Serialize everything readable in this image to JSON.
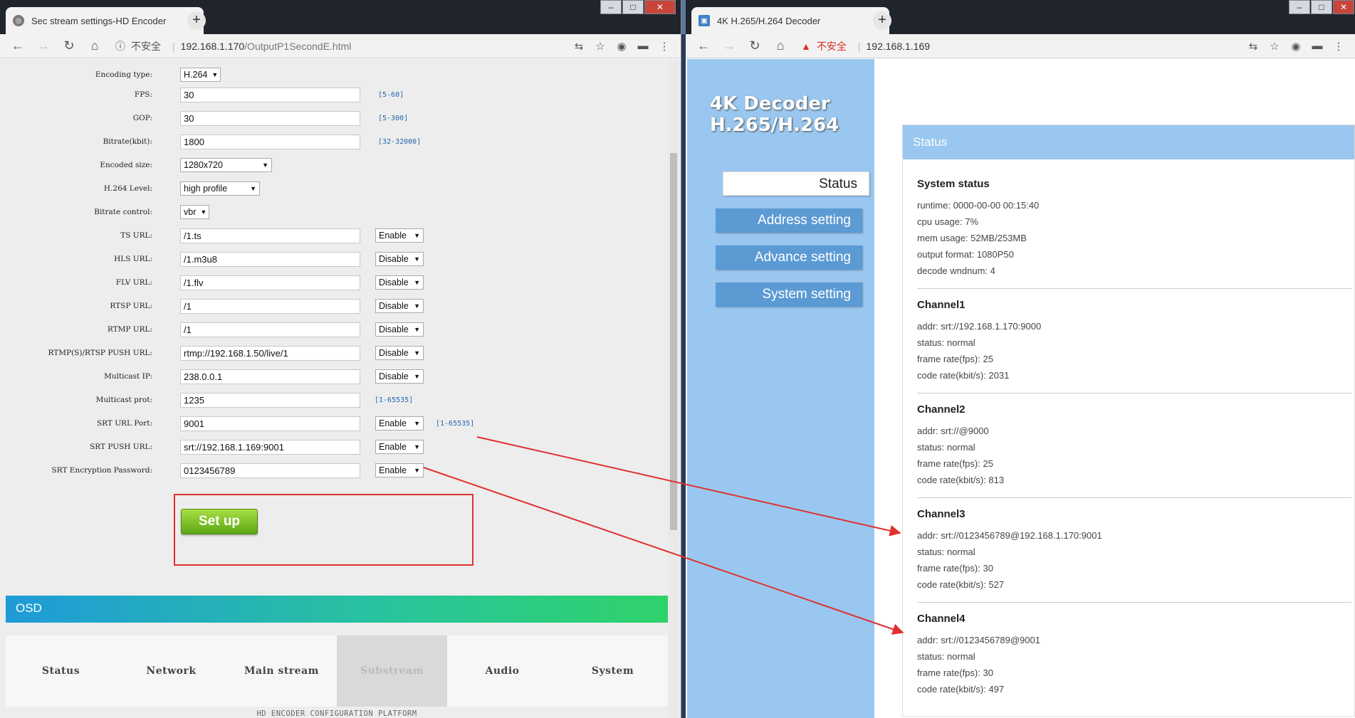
{
  "left_window": {
    "tab_title": "Sec stream settings-HD Encoder",
    "security": "不安全",
    "url_host": "192.168.1.170",
    "url_path": "/OutputP1SecondE.html",
    "form": {
      "encoding_type": {
        "label": "Encoding type:",
        "value": "H.264"
      },
      "fps": {
        "label": "FPS:",
        "value": "30",
        "hint": "[5-60]"
      },
      "gop": {
        "label": "GOP:",
        "value": "30",
        "hint": "[5-300]"
      },
      "bitrate": {
        "label": "Bitrate(kbit):",
        "value": "1800",
        "hint": "[32-32000]"
      },
      "encoded_size": {
        "label": "Encoded size:",
        "value": "1280x720"
      },
      "h264_level": {
        "label": "H.264 Level:",
        "value": "high profile"
      },
      "bitrate_control": {
        "label": "Bitrate control:",
        "value": "vbr"
      },
      "ts_url": {
        "label": "TS URL:",
        "value": "/1.ts",
        "state": "Enable"
      },
      "hls_url": {
        "label": "HLS URL:",
        "value": "/1.m3u8",
        "state": "Disable"
      },
      "flv_url": {
        "label": "FLV URL:",
        "value": "/1.flv",
        "state": "Disable"
      },
      "rtsp_url": {
        "label": "RTSP URL:",
        "value": "/1",
        "state": "Disable"
      },
      "rtmp_url": {
        "label": "RTMP URL:",
        "value": "/1",
        "state": "Disable"
      },
      "rtmp_push_url": {
        "label": "RTMP(S)/RTSP PUSH URL:",
        "value": "rtmp://192.168.1.50/live/1",
        "state": "Disable"
      },
      "multicast_ip": {
        "label": "Multicast IP:",
        "value": "238.0.0.1",
        "state": "Disable"
      },
      "multicast_port": {
        "label": "Multicast prot:",
        "value": "1235",
        "hint": "[1-65535]"
      },
      "srt_url_port": {
        "label": "SRT URL Port:",
        "value": "9001",
        "state": "Enable",
        "hint": "[1-65535]"
      },
      "srt_push_url": {
        "label": "SRT PUSH URL:",
        "value": "srt://192.168.1.169:9001",
        "state": "Enable"
      },
      "srt_password": {
        "label": "SRT Encryption Password:",
        "value": "0123456789",
        "state": "Enable"
      }
    },
    "setup_label": "Set up",
    "osd_label": "OSD",
    "nav": [
      "Status",
      "Network",
      "Main stream",
      "Substream",
      "Audio",
      "System"
    ],
    "nav_active": "Substream",
    "footer": "HD ENCODER CONFIGURATION PLATFORM"
  },
  "right_window": {
    "tab_title": "4K H.265/H.264 Decoder",
    "security": "不安全",
    "url_host": "192.168.1.169",
    "logo_line1": "4K Decoder",
    "logo_line2": "H.265/H.264",
    "menu": [
      "Status",
      "Address setting",
      "Advance setting",
      "System setting"
    ],
    "menu_active": "Status",
    "panel_title": "Status",
    "system": {
      "title": "System status",
      "lines": [
        "runtime: 0000-00-00 00:15:40",
        "cpu usage: 7%",
        "mem usage: 52MB/253MB",
        "output format: 1080P50",
        "decode wndnum: 4"
      ]
    },
    "channels": [
      {
        "title": "Channel1",
        "lines": [
          "addr: srt://192.168.1.170:9000",
          "status: normal",
          "frame rate(fps): 25",
          "code rate(kbit/s): 2031"
        ]
      },
      {
        "title": "Channel2",
        "lines": [
          "addr: srt://@9000",
          "status: normal",
          "frame rate(fps): 25",
          "code rate(kbit/s): 813"
        ]
      },
      {
        "title": "Channel3",
        "lines": [
          "addr: srt://0123456789@192.168.1.170:9001",
          "status: normal",
          "frame rate(fps): 30",
          "code rate(kbit/s): 527"
        ]
      },
      {
        "title": "Channel4",
        "lines": [
          "addr: srt://0123456789@9001",
          "status: normal",
          "frame rate(fps): 30",
          "code rate(kbit/s): 497"
        ]
      }
    ]
  },
  "icons": [
    "page-icon",
    "close-icon",
    "new-tab-icon",
    "back-icon",
    "forward-icon",
    "reload-icon",
    "home-icon",
    "info-icon",
    "warning-icon",
    "translate-icon",
    "star-icon",
    "extension-icon",
    "menu-icon"
  ],
  "colors": {
    "accent_red": "#e03030",
    "decoder_side": "#99c7ef",
    "decoder_button": "#5b9ad3",
    "setup_green": "#7cc52a"
  }
}
